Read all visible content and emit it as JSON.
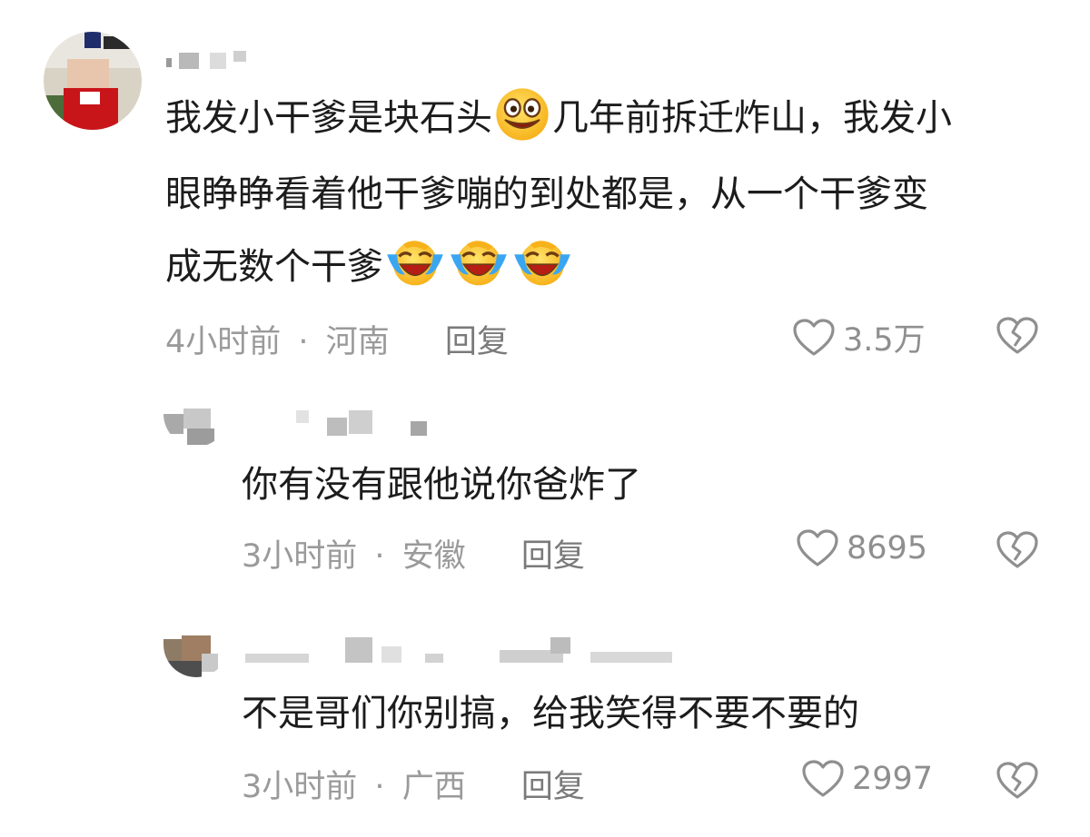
{
  "comments": [
    {
      "text_lines": [
        "我发小干爹是块石头",
        "几年前拆迁炸山，我发小",
        "眼睁睁看着他干爹嘣的到处都是，从一个干爹变",
        "成无数个干爹"
      ],
      "time": "4小时前",
      "location": "河南",
      "reply_label": "回复",
      "likes": "3.5万",
      "emoji_inline": "grin-emoji",
      "emoji_trailing": [
        "crying-laughing-emoji",
        "crying-laughing-emoji",
        "crying-laughing-emoji"
      ]
    },
    {
      "text": "你有没有跟他说你爸炸了",
      "time": "3小时前",
      "location": "安徽",
      "reply_label": "回复",
      "likes": "8695"
    },
    {
      "text": "不是哥们你别搞，给我笑得不要不要的",
      "time": "3小时前",
      "location": "广西",
      "reply_label": "回复",
      "likes": "2997"
    }
  ],
  "separator": "·",
  "colors": {
    "text": "#1c1c1c",
    "meta": "#9a9a9a",
    "icon": "#8f8f8f"
  },
  "icons": {
    "like": "heart-outline-icon",
    "dislike": "broken-heart-icon"
  }
}
